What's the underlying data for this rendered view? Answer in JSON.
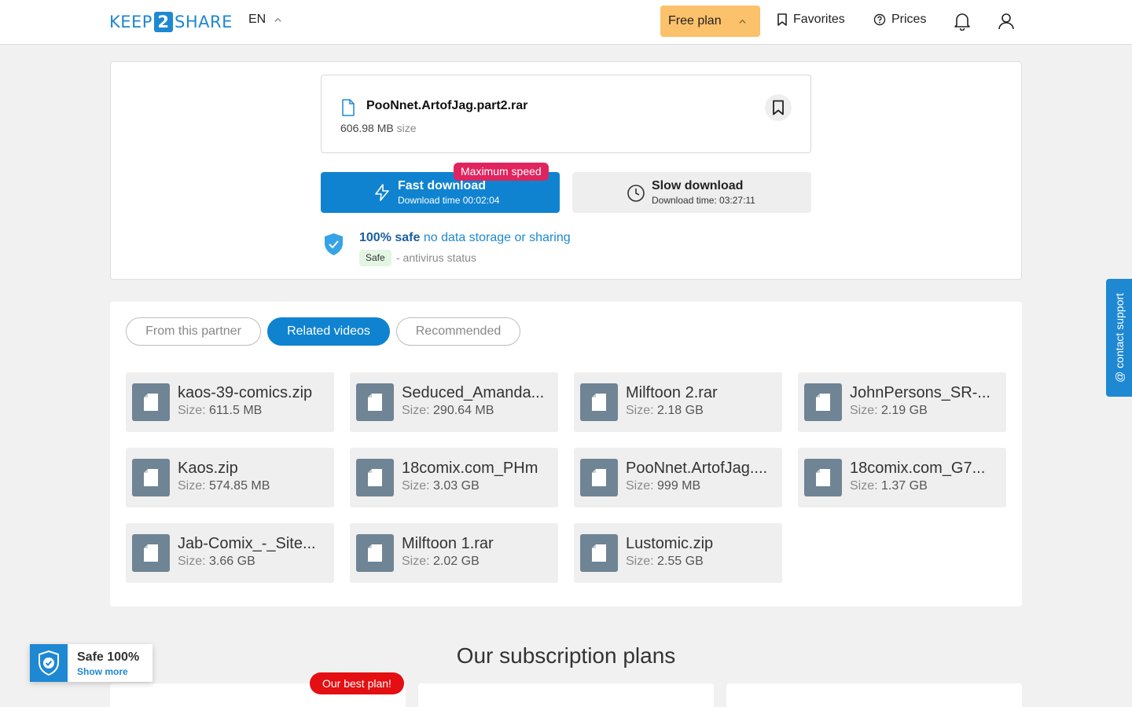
{
  "header": {
    "logo_left": "KEEP",
    "logo_mid": "2",
    "logo_right": "SHARE",
    "lang": "EN",
    "plan_label": "Free plan",
    "favorites_label": "Favorites",
    "prices_label": "Prices"
  },
  "file": {
    "name": "PooNnet.ArtofJag.part2.rar",
    "size_value": "606.98 MB",
    "size_label": "size"
  },
  "download": {
    "fast_title": "Fast download",
    "fast_sub": "Download time 00:02:04",
    "max_badge": "Maximum speed",
    "slow_title": "Slow download",
    "slow_sub": "Download time: 03:27:11"
  },
  "safety": {
    "bold": "100% safe",
    "rest": " no data storage or sharing",
    "badge": "Safe",
    "antivirus": "- antivirus status"
  },
  "tabs": [
    "From this partner",
    "Related videos",
    "Recommended"
  ],
  "active_tab": "Related videos",
  "size_label": "Size:",
  "items": [
    {
      "name": "kaos-39-comics.zip",
      "size": "611.5 MB"
    },
    {
      "name": "Seduced_Amanda...",
      "size": "290.64 MB"
    },
    {
      "name": "Milftoon 2.rar",
      "size": "2.18 GB"
    },
    {
      "name": "JohnPersons_SR-...",
      "size": "2.19 GB"
    },
    {
      "name": "Kaos.zip",
      "size": "574.85 MB"
    },
    {
      "name": "18comix.com_PHm",
      "size": "3.03 GB"
    },
    {
      "name": "PooNnet.ArtofJag....",
      "size": "999 MB"
    },
    {
      "name": "18comix.com_G7...",
      "size": "1.37 GB"
    },
    {
      "name": "Jab-Comix_-_Site...",
      "size": "3.66 GB"
    },
    {
      "name": "Milftoon 1.rar",
      "size": "2.02 GB"
    },
    {
      "name": "Lustomic.zip",
      "size": "2.55 GB"
    }
  ],
  "plans": {
    "title": "Our subscription plans",
    "best_badge": "Our best plan!"
  },
  "safe_widget": {
    "title": "Safe 100%",
    "link": "Show more"
  },
  "support_tab": "@ contact support",
  "colors": {
    "primary": "#0f83d0",
    "plan_button": "#fcc16b",
    "max_badge": "#e0245e",
    "best_badge": "#e30f12"
  }
}
